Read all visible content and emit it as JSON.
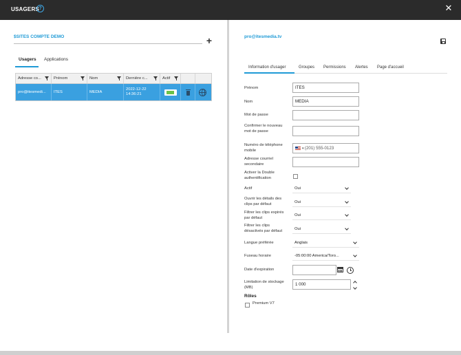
{
  "titlebar": {
    "title": "USAGERS",
    "help_glyph": "?",
    "close_glyph": "✕"
  },
  "left": {
    "account_title": "$SITES COMPTE DEMO",
    "add_glyph": "+",
    "tabs": [
      {
        "label": "Usagers"
      },
      {
        "label": "Applications"
      }
    ],
    "grid": {
      "columns": [
        "Adresse co...",
        "Prénom",
        "Nom",
        "Dernière c...",
        "Actif"
      ],
      "row": {
        "email": "pro@itesmedi...",
        "first": "ITES",
        "last": "MEDIA",
        "date": "2022-12-22",
        "time": "14:36:21"
      }
    }
  },
  "right": {
    "email": "pro@itesmedia.tv",
    "tabs": [
      "Information d'usager",
      "Groupes",
      "Permissions",
      "Alertes",
      "Page d'accueil"
    ],
    "labels": {
      "prenom": "Prénom",
      "nom": "Nom",
      "password": "Mot de passe",
      "confirm": "Confirmer le nouveau mot de passe",
      "phone": "Numéro de téléphone mobile",
      "email2": "Adresse courriel secondaire",
      "twofa": "Activer la Double authentification",
      "actif": "Actif",
      "open_details": "Ouvrir les détails des clips par défaut",
      "filter_expired": "Filtrer les clips expirés par défaut",
      "filter_disabled": "Filtrer les clips désactivés par défaut",
      "language": "Langue préférée",
      "timezone": "Fuseau horaire",
      "expiration": "Date d'expiration",
      "storage": "Limitation de stockage (MB)"
    },
    "values": {
      "prenom": "ITES",
      "nom": "MEDIA",
      "phone_placeholder": "(201) 555-0123",
      "actif": "Oui",
      "open_details": "Oui",
      "filter_expired": "Oui",
      "filter_disabled": "Oui",
      "language": "Anglais",
      "timezone": "-05:00:00 America/Toro...",
      "storage": "1 000"
    },
    "roles_title": "Rôles",
    "roles": [
      {
        "label": "Premium V7"
      }
    ]
  }
}
